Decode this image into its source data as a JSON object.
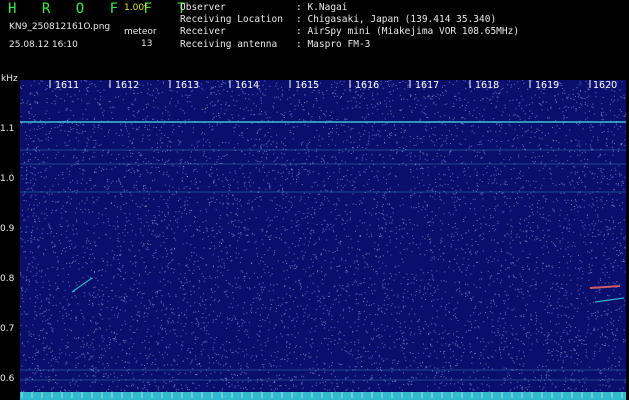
{
  "header": {
    "logo": "H R O F F T",
    "version": "1.00f",
    "filename": "KN9_250812161O.png",
    "mode": "meteor",
    "count": "13",
    "datetime": "25.08.12 16:10",
    "info": [
      {
        "label": "Observer",
        "value": ": K.Nagai"
      },
      {
        "label": "Receiving Location",
        "value": ": Chigasaki, Japan (139.414 35.340)"
      },
      {
        "label": "Receiver",
        "value": ": AirSpy mini (Miakejima VOR 108.65MHz)"
      },
      {
        "label": "Receiving antenna",
        "value": ": Maspro FM-3"
      }
    ]
  },
  "axis": {
    "unit": "kHz",
    "y_labels": [
      "1.1",
      "1.0",
      "0.9",
      "0.8",
      "0.7",
      "0.6"
    ],
    "x_labels": [
      "1611",
      "1612",
      "1613",
      "1614",
      "1615",
      "1616",
      "1617",
      "1618",
      "1619",
      "1620"
    ]
  },
  "colors": {
    "background": "#0a0f6e",
    "carrier_line": "#3ad8e0",
    "noise_bright": "#9aa8ff",
    "logo": "#39e64a",
    "version": "#e0e020"
  }
}
